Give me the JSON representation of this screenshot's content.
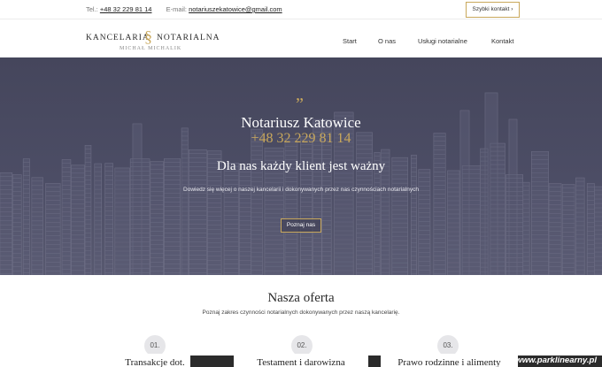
{
  "topbar": {
    "phone_label": "Tel.:",
    "phone": "+48 32 229 81 14",
    "email_label": "E-mail:",
    "email": "notariuszekatowice@gmail.com",
    "quick_contact": "Szybki kontakt ›"
  },
  "logo": {
    "left_word": "KANCELARIA",
    "symbol": "§",
    "right_word": "NOTARIALNA",
    "name": "MICHAŁ MICHALIK"
  },
  "nav": {
    "items": [
      {
        "label": "Start"
      },
      {
        "label": "O nas"
      },
      {
        "label": "Usługi notarialne"
      },
      {
        "label": "Kontakt"
      }
    ]
  },
  "hero": {
    "quote_mark": "”",
    "title": "Notariusz Katowice",
    "phone": "+48 32 229 81 14",
    "headline": "Dla nas każdy klient jest ważny",
    "description": "Dowiedz się więcej o naszej kancelarii i dokonywanych przez nas czynnościach notarialnych",
    "button": "Poznaj nas"
  },
  "offer": {
    "title": "Nasza oferta",
    "subtitle": "Poznaj zakres czynności notarialnych dokonywanych przez naszą kancelarię.",
    "items": [
      {
        "number": "01.",
        "title": "Transakcje dot."
      },
      {
        "number": "02.",
        "title": "Testament i darowizna"
      },
      {
        "number": "03.",
        "title": "Prawo rodzinne i alimenty"
      }
    ]
  },
  "watermark": "www.parklinearny.pl",
  "colors": {
    "accent_gold": "#c9a85c",
    "hero_bg": "#4a4b63"
  }
}
